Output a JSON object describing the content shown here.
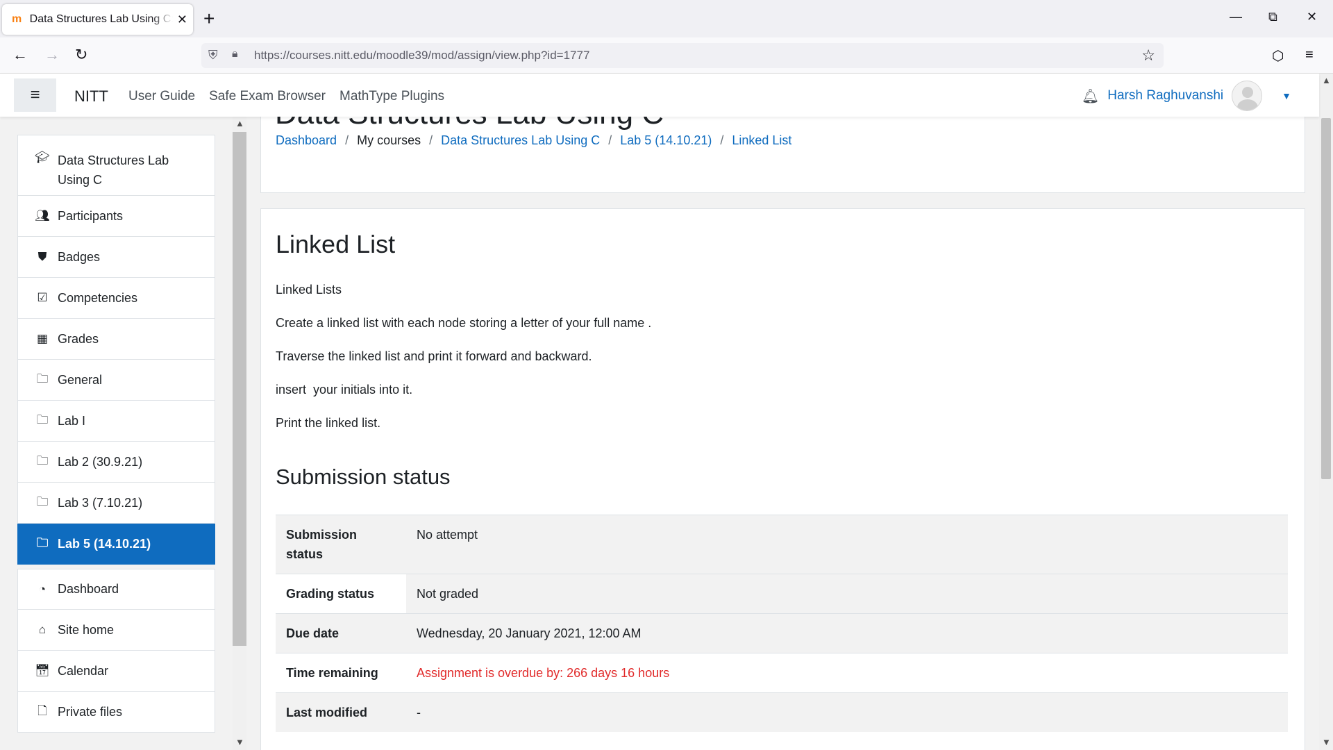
{
  "browser": {
    "tab_title": "Data Structures Lab Using C: Linked List",
    "tab_close": "✕",
    "new_tab": "+",
    "url": "https://courses.nitt.edu/moodle39/mod/assign/view.php?id=1777",
    "icons": [
      "back-icon",
      "forward-icon",
      "reload-icon",
      "shield-icon",
      "lock-icon",
      "star-icon",
      "pocket-icon",
      "menu-icon"
    ]
  },
  "topnav": {
    "site_name": "NITT",
    "links": [
      "User Guide",
      "Safe Exam Browser",
      "MathType Plugins"
    ],
    "user_name": "Harsh Raghuvanshi"
  },
  "drawer": {
    "items": [
      {
        "label": "Data Structures Lab Using C",
        "icon": "graduation-cap-icon"
      },
      {
        "label": "Participants",
        "icon": "users-icon"
      },
      {
        "label": "Badges",
        "icon": "shield-badge-icon"
      },
      {
        "label": "Competencies",
        "icon": "check-square-icon"
      },
      {
        "label": "Grades",
        "icon": "table-icon"
      },
      {
        "label": "General",
        "icon": "folder-icon"
      },
      {
        "label": "Lab I",
        "icon": "folder-icon"
      },
      {
        "label": "Lab 2 (30.9.21)",
        "icon": "folder-icon"
      },
      {
        "label": "Lab 3 (7.10.21)",
        "icon": "folder-icon"
      },
      {
        "label": "Lab 5 (14.10.21)",
        "icon": "folder-icon",
        "active": true
      },
      {
        "label": "Dashboard",
        "icon": "dashboard-icon"
      },
      {
        "label": "Site home",
        "icon": "home-icon"
      },
      {
        "label": "Calendar",
        "icon": "calendar-icon"
      },
      {
        "label": "Private files",
        "icon": "file-icon"
      }
    ]
  },
  "main": {
    "course_title": "Data Structures Lab Using C",
    "breadcrumb": {
      "dashboard": "Dashboard",
      "my_courses": "My courses",
      "course": "Data Structures Lab Using C",
      "section": "Lab 5 (14.10.21)",
      "activity": "Linked List",
      "separator": "/"
    },
    "activity_title": "Linked List",
    "intro": [
      "Linked Lists",
      "Create a linked list with each node storing a letter of your full name .",
      "Traverse the linked list and print it forward and backward.",
      "insert  your initials into it.",
      "Print the linked list."
    ],
    "submission_heading": "Submission status",
    "status": {
      "submission_status_label": "Submission status",
      "submission_status_value": "No attempt",
      "grading_status_label": "Grading status",
      "grading_status_value": "Not graded",
      "due_date_label": "Due date",
      "due_date_value": "Wednesday, 20 January 2021, 12:00 AM",
      "time_remaining_label": "Time remaining",
      "time_remaining_value": "Assignment is overdue by: 266 days 16 hours",
      "last_modified_label": "Last modified",
      "last_modified_value": "-"
    }
  },
  "colors": {
    "brand": "#0f6cbf",
    "overdue": "#e12a2a",
    "drawer_bg": "#f2f2f2"
  }
}
